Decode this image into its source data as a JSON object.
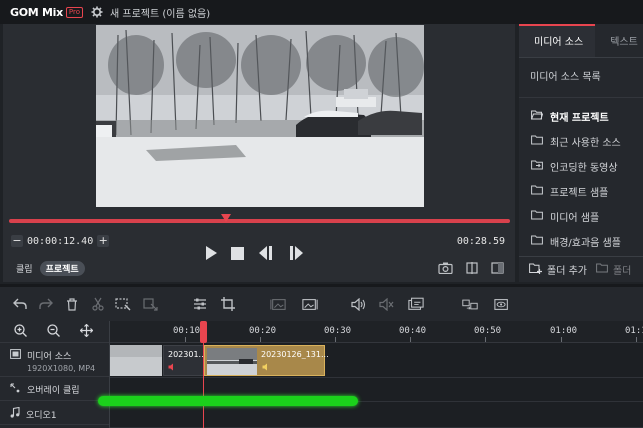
{
  "app": {
    "logo": "GOM Mix",
    "logo_badge": "Pro",
    "project_title": "새 프로젝트 (이름 없음)"
  },
  "preview": {
    "current_time": "00:00:12.40",
    "total_time": "00:28.59",
    "progress": 0.434,
    "mode_clip": "클립",
    "mode_project": "프로젝트",
    "selected_mode": "프로젝트"
  },
  "media_panel": {
    "tabs": [
      {
        "label": "미디어 소스",
        "active": true
      },
      {
        "label": "텍스트",
        "active": false
      }
    ],
    "list_title": "미디어 소스 목록",
    "items": [
      {
        "label": "현재 프로젝트",
        "icon": "folder-open-icon",
        "selected": true
      },
      {
        "label": "최근 사용한 소스",
        "icon": "folder-icon",
        "selected": false
      },
      {
        "label": "인코딩한 동영상",
        "icon": "folder-export-icon",
        "selected": false
      },
      {
        "label": "프로젝트 샘플",
        "icon": "folder-icon",
        "selected": false
      },
      {
        "label": "미디어 샘플",
        "icon": "folder-icon",
        "selected": false
      },
      {
        "label": "배경/효과음 샘플",
        "icon": "folder-icon",
        "selected": false
      }
    ],
    "add_folder": "폴더 추가",
    "delete_folder": "폴더"
  },
  "timeline": {
    "ruler": [
      "00:10",
      "00:20",
      "00:30",
      "00:40",
      "00:50",
      "01:00",
      "01:1"
    ],
    "tracks": {
      "media": {
        "label": "미디어 소스",
        "info": "1920X1080, MP4"
      },
      "overlay": {
        "label": "오버레이 클립"
      },
      "audio": {
        "label": "오디오1"
      }
    },
    "clips": [
      {
        "name": ""
      },
      {
        "name": "202301..."
      },
      {
        "name": "20230126_131..."
      }
    ]
  },
  "colors": {
    "accent": "#e8454f",
    "highlight": "#1bd11b",
    "clip_selected": "#a8884a"
  }
}
